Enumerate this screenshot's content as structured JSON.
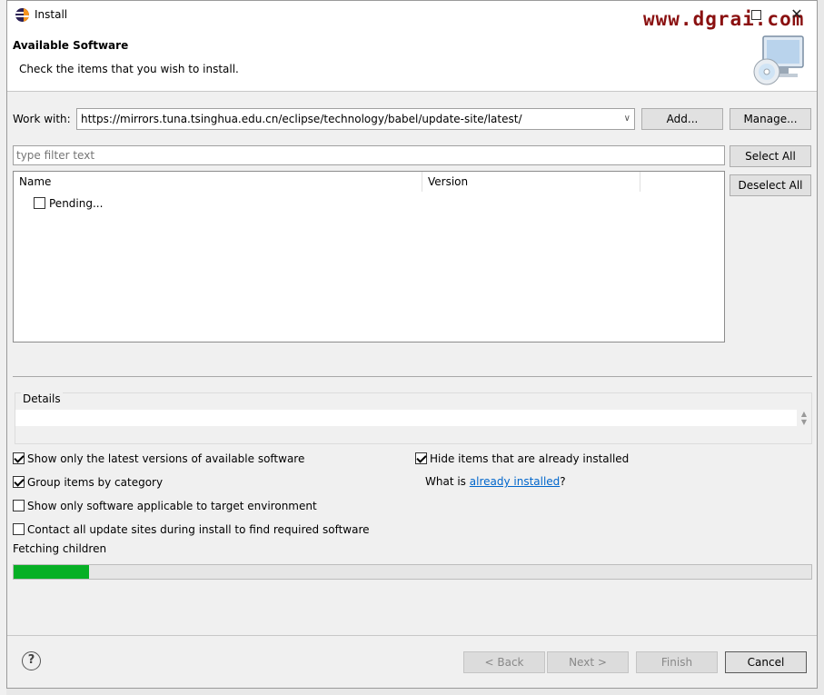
{
  "window": {
    "title": "Install",
    "watermark": "www.dgrai.com",
    "close_glyph": "✕"
  },
  "banner": {
    "title": "Available Software",
    "subtitle": "Check the items that you wish to install.",
    "icon": "computer-cd-icon"
  },
  "work_with": {
    "label": "Work with:",
    "value": "https://mirrors.tuna.tsinghua.edu.cn/eclipse/technology/babel/update-site/latest/",
    "add_label": "Add...",
    "manage_label": "Manage..."
  },
  "filter": {
    "placeholder": "type filter text",
    "select_all_label": "Select All",
    "deselect_all_label": "Deselect All"
  },
  "tree": {
    "columns": [
      "Name",
      "Version"
    ],
    "rows": [
      {
        "label": "Pending...",
        "checked": false
      }
    ]
  },
  "details": {
    "label": "Details"
  },
  "options": {
    "show_latest": {
      "label": "Show only the latest versions of available software",
      "checked": true
    },
    "group_by_category": {
      "label": "Group items by category",
      "checked": true
    },
    "applicable_only": {
      "label": "Show only software applicable to target environment",
      "checked": false
    },
    "contact_sites": {
      "label": "Contact all update sites during install to find required software",
      "checked": false
    },
    "hide_installed": {
      "label": "Hide items that are already installed",
      "checked": true
    },
    "what_is_prefix": "What is ",
    "already_installed_link": "already installed",
    "what_is_suffix": "?"
  },
  "status": {
    "text": "Fetching children",
    "progress": 0.095,
    "progress_color": "#06b025"
  },
  "footer": {
    "help_glyph": "?",
    "back_label": "< Back",
    "next_label": "Next >",
    "finish_label": "Finish",
    "cancel_label": "Cancel"
  }
}
